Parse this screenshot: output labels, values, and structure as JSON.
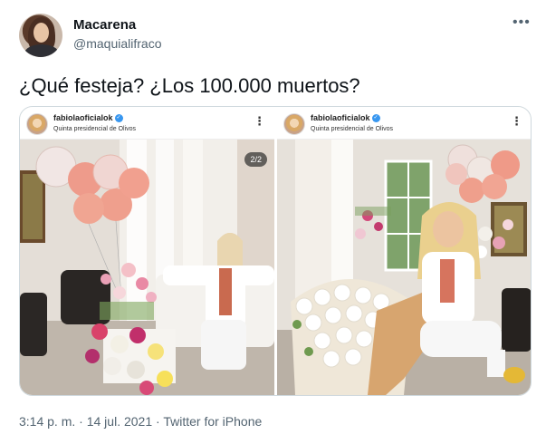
{
  "author": {
    "name": "Macarena",
    "handle": "@maquialifraco"
  },
  "tweet": {
    "text": "¿Qué festeja? ¿Los 100.000 muertos?",
    "more_icon": "more-horizontal-icon"
  },
  "media": {
    "left": {
      "ig_user": "fabiolaoficialok",
      "ig_location": "Quinta presidencial de Olivos",
      "counter": "2/2"
    },
    "right": {
      "ig_user": "fabiolaoficialok",
      "ig_location": "Quinta presidencial de Olivos"
    }
  },
  "meta": {
    "time": "3:14 p. m.",
    "separator": "·",
    "date": "14 jul. 2021",
    "source": "Twitter for iPhone"
  }
}
